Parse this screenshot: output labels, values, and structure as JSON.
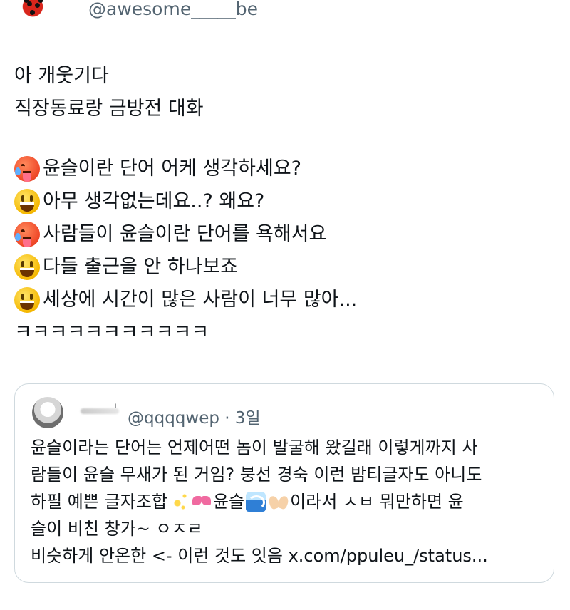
{
  "author": {
    "handle": "@awesome_____be"
  },
  "tweet": {
    "lines": [
      "아 개웃기다",
      "직장동료랑 금방전 대화",
      "윤슬이란 단어 어케 생각하세요?",
      "아무 생각없는데요..? 왜요?",
      "사람들이 윤슬이란 단어를 욕해서요",
      "다들 출근을 안 하나보죠",
      "세상에 시간이 많은 사람이 너무 많아...",
      "ㅋㅋㅋㅋㅋㅋㅋㅋㅋㅋㅋ"
    ],
    "emojis": [
      "hot-face",
      "grinning-face",
      "hot-face",
      "grinning-face",
      "grinning-face"
    ]
  },
  "quote": {
    "author_name_fragment": "ˈ",
    "handle_meta": "@qqqqwep · 3일",
    "lines": {
      "l1": "윤슬이라는 단어는 언제어떤 놈이 발굴해 왔길래 이렇게까지 사",
      "l2": "람들이 윤슬 무새가 된 거임? 붕선 경숙 이런 밤티글자도 아니도",
      "l3a": "하필 예쁜 글자조합 ",
      "l3b": "윤슬",
      "l3c": "이라서 ㅅㅂ 뭐만하면 윤",
      "l4": "슬이 비친 창가~ ㅇㅈㄹ",
      "l5": "비슷하게 안온한 <- 이런 것도 잇음 x.com/ppuleu_/status..."
    },
    "emojis": [
      "sparkles",
      "ribbon",
      "water-wave",
      "heart-hands"
    ]
  }
}
